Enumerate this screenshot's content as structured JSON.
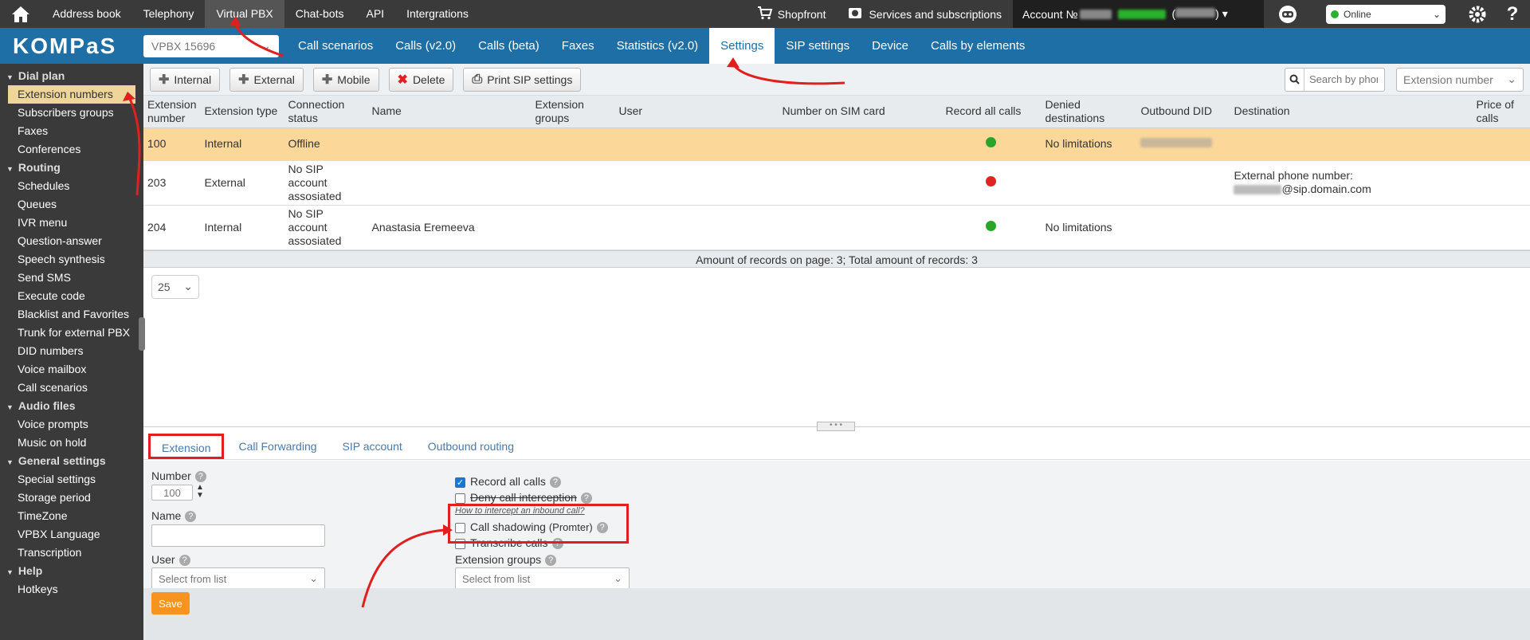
{
  "topbar": {
    "nav": [
      "Address book",
      "Telephony",
      "Virtual PBX",
      "Chat-bots",
      "API",
      "Intergrations"
    ],
    "active_index": 2,
    "shopfront": "Shopfront",
    "services": "Services and subscriptions",
    "account_label": "Account №",
    "status": "Online"
  },
  "secbar": {
    "logo": "KOMPaS",
    "vpbx_select": "VPBX 15696",
    "tabs": [
      "Call scenarios",
      "Calls (v2.0)",
      "Calls (beta)",
      "Faxes",
      "Statistics (v2.0)",
      "Settings",
      "SIP settings",
      "Device",
      "Calls by elements"
    ],
    "active_index": 5
  },
  "sidebar": {
    "sections": [
      {
        "title": "Dial plan",
        "items": [
          "Extension numbers",
          "Subscribers groups",
          "Faxes",
          "Conferences"
        ]
      },
      {
        "title": "Routing",
        "items": [
          "Schedules",
          "Queues",
          "IVR menu",
          "Question-answer",
          "Speech synthesis",
          "Send SMS",
          "Execute code",
          "Blacklist and Favorites",
          "Trunk for external PBX",
          "DID numbers",
          "Voice mailbox",
          "Call scenarios"
        ]
      },
      {
        "title": "Audio files",
        "items": [
          "Voice prompts",
          "Music on hold"
        ]
      },
      {
        "title": "General settings",
        "items": [
          "Special settings",
          "Storage period",
          "TimeZone",
          "VPBX Language",
          "Transcription"
        ]
      },
      {
        "title": "Help",
        "items": [
          "Hotkeys"
        ]
      }
    ],
    "active_item": "Extension numbers"
  },
  "toolbar": {
    "internal": "Internal",
    "external": "External",
    "mobile": "Mobile",
    "delete": "Delete",
    "print": "Print SIP settings",
    "search_placeholder": "Search by phone nu",
    "sort_select": "Extension number"
  },
  "table": {
    "headers": [
      "Extension number",
      "Extension type",
      "Connection status",
      "Name",
      "Extension groups",
      "User",
      "Number on SIM card",
      "Record all calls",
      "Denied destinations",
      "Outbound DID",
      "Destination",
      "Price of calls"
    ],
    "rows": [
      {
        "number": "100",
        "type": "Internal",
        "status": "Offline",
        "name": "",
        "record": "green",
        "denied": "No limitations",
        "destination": ""
      },
      {
        "number": "203",
        "type": "External",
        "status": "No SIP account assosiated",
        "name": "",
        "record": "red",
        "denied": "",
        "destination": "External phone number:",
        "destination2": "@sip.domain.com"
      },
      {
        "number": "204",
        "type": "Internal",
        "status": "No SIP account assosiated",
        "name": "Anastasia Eremeeva",
        "record": "green",
        "denied": "No limitations",
        "destination": ""
      }
    ],
    "summary": "Amount of records on page: 3; Total amount of records: 3",
    "page_size": "25"
  },
  "detail": {
    "tabs": [
      "Extension",
      "Call Forwarding",
      "SIP account",
      "Outbound routing"
    ],
    "active_tab": 0,
    "number_label": "Number",
    "number_value": "100",
    "name_label": "Name",
    "user_label": "User",
    "user_placeholder": "Select from list",
    "record_all_calls": "Record all calls",
    "deny_interception": "Deny call interception",
    "intercept_link": "How to intercept an inbound call?",
    "call_shadowing": "Call shadowing",
    "promter": "(Promter)",
    "transcribe": "Transcribe calls",
    "ext_groups_label": "Extension groups",
    "ext_groups_placeholder": "Select from list",
    "save": "Save"
  },
  "colors": {
    "top_bar": "#3a3a3a",
    "brand_blue": "#1d6fa5",
    "selected_row": "#fbd79a",
    "highlight_red": "#e02020",
    "save_orange": "#f7931e"
  }
}
